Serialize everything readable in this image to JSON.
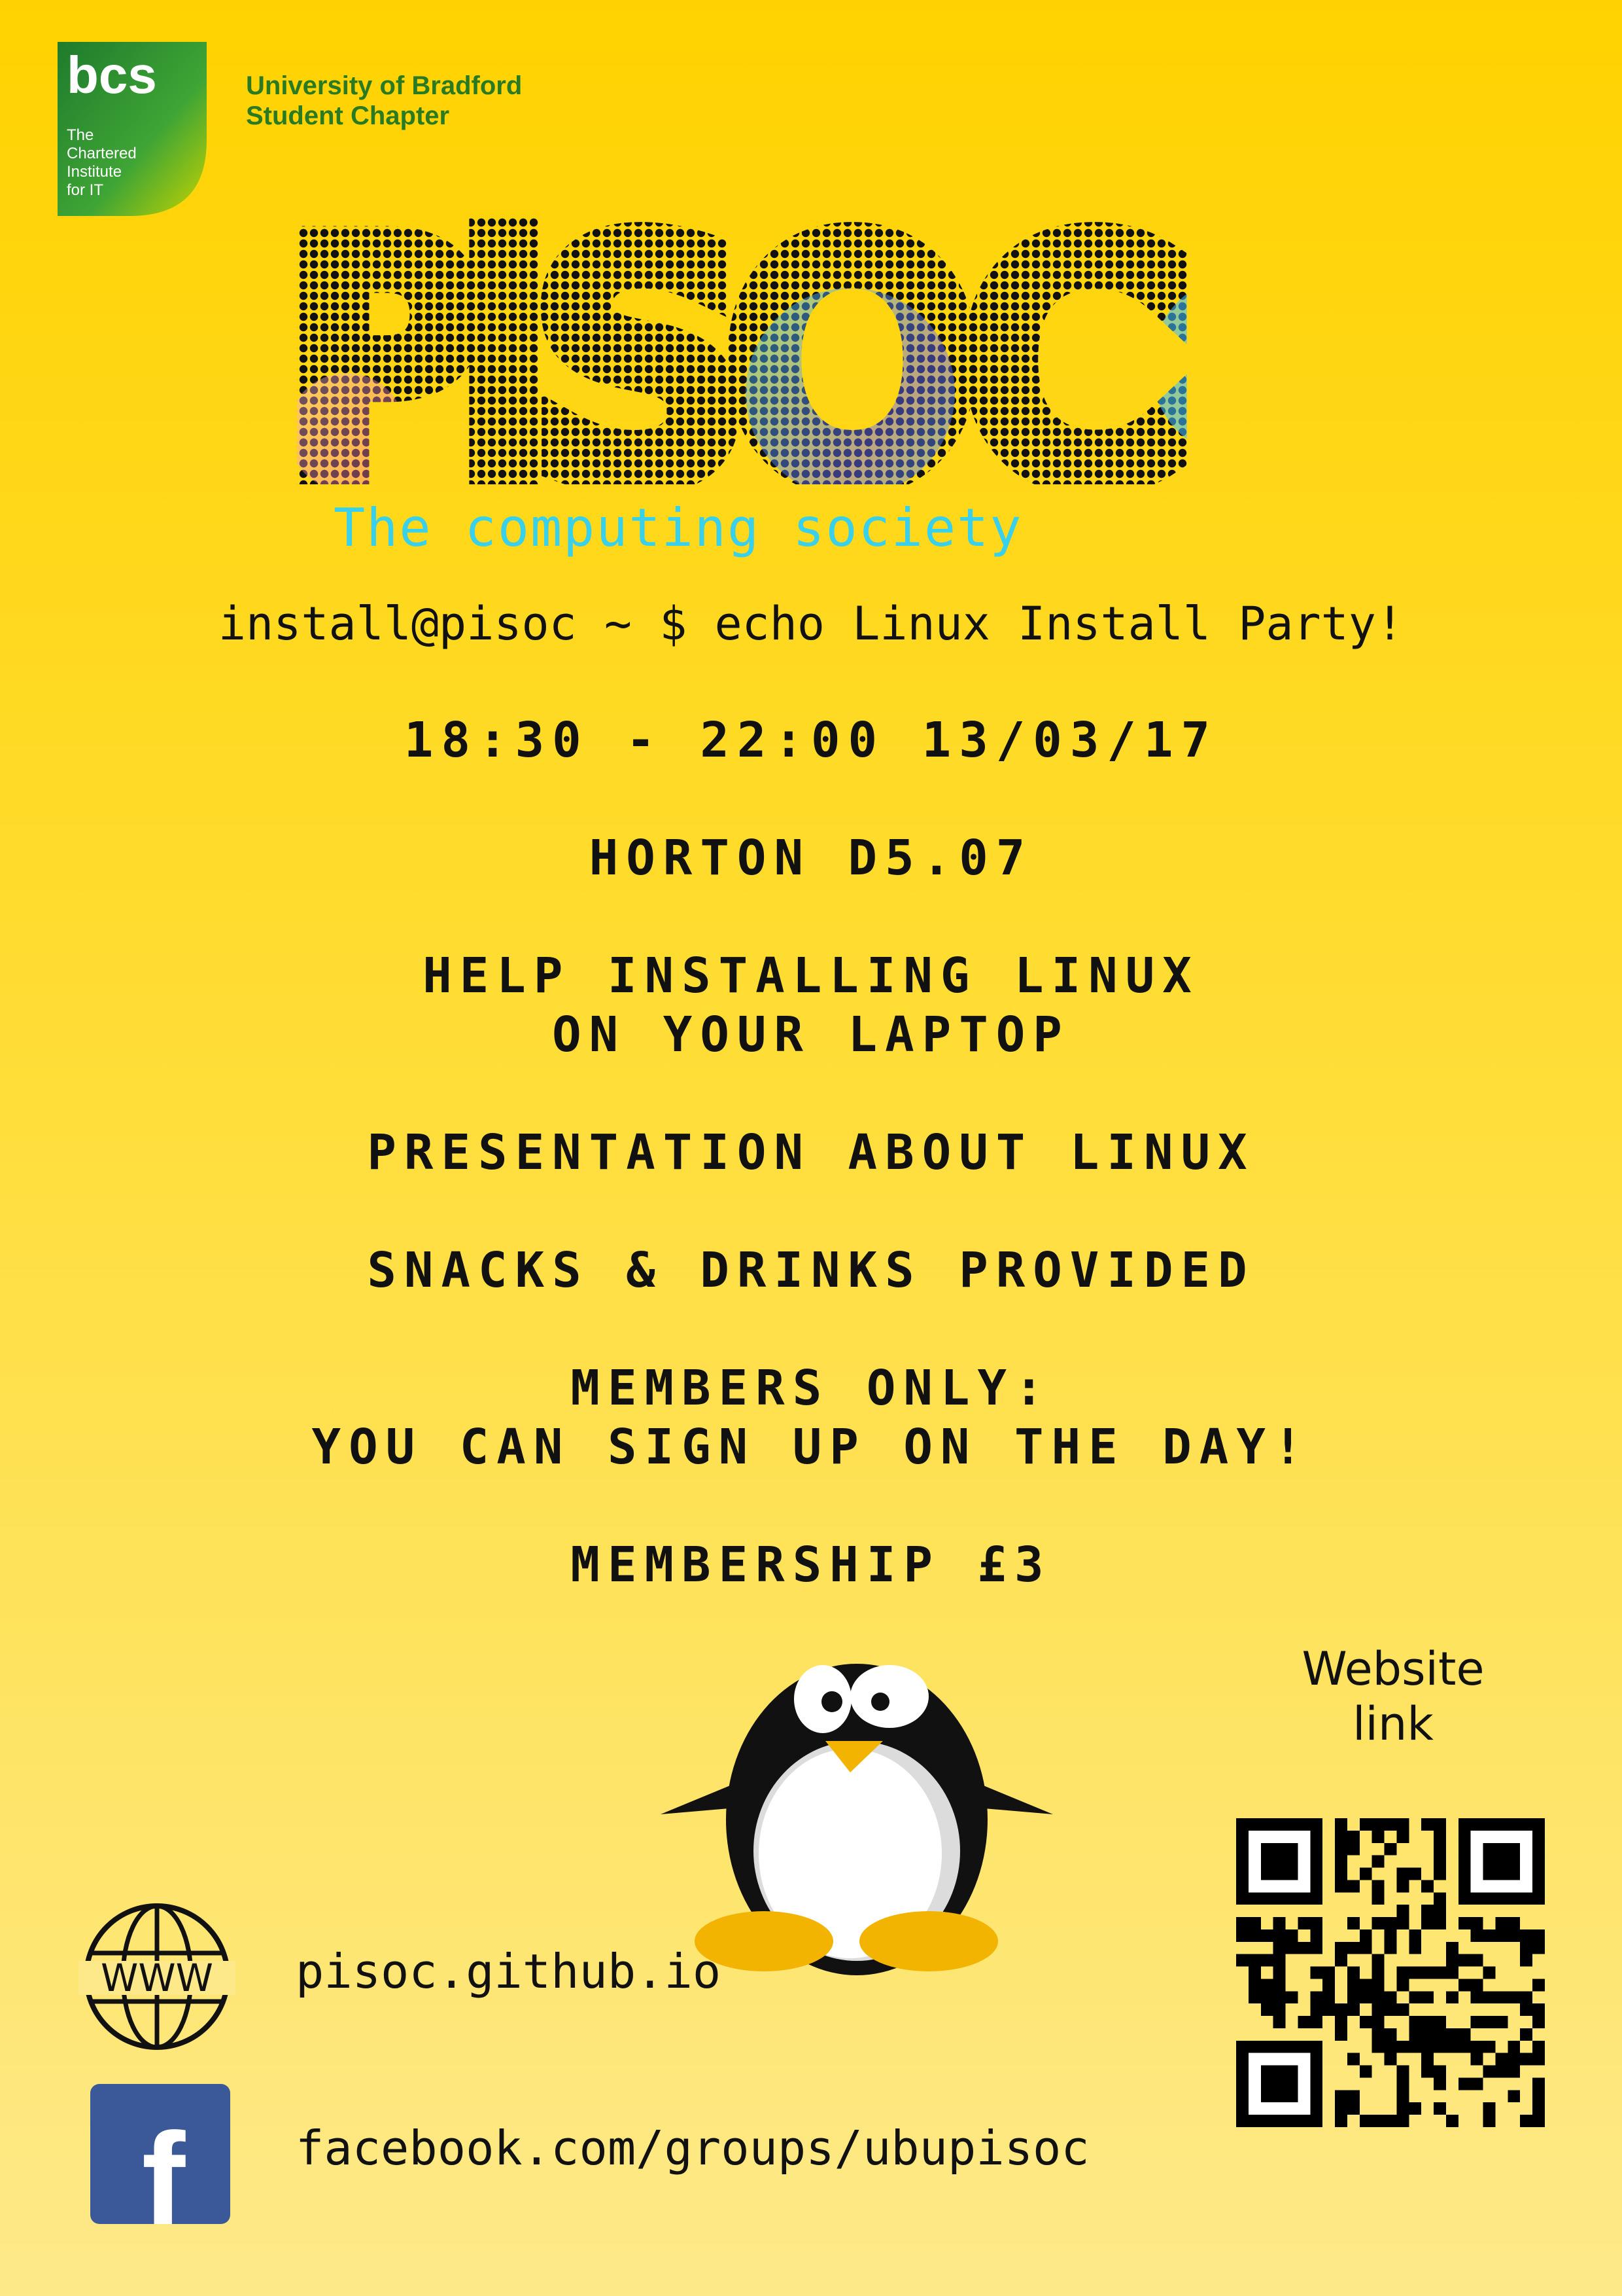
{
  "logo": {
    "bcs_text": "bcs",
    "institute_lines": [
      "The",
      "Chartered",
      "Institute",
      "for IT"
    ]
  },
  "chapter": {
    "line1": "University of Bradford",
    "line2": "Student Chapter"
  },
  "title": "PiSOC",
  "tagline": "The computing society",
  "command": "install@pisoc ~ $ echo Linux Install Party!",
  "details": {
    "time": "18:30 - 22:00 13/03/17",
    "location": "HORTON D5.07",
    "help_line1": "HELP INSTALLING LINUX",
    "help_line2": "ON YOUR LAPTOP",
    "presentation": "PRESENTATION ABOUT LINUX",
    "snacks": "SNACKS & DRINKS PROVIDED",
    "members_line1": "MEMBERS ONLY:",
    "members_line2": "YOU CAN SIGN UP ON THE DAY!",
    "membership": "MEMBERSHIP £3"
  },
  "website_label": {
    "line1": "Website",
    "line2": "link"
  },
  "links": {
    "website": "pisoc.github.io",
    "www_icon_text": "WWW",
    "facebook": "facebook.com/groups/ubupisoc",
    "facebook_glyph": "f"
  },
  "colors": {
    "bg_top": "#ffd200",
    "bg_bottom": "#fee98a",
    "tagline": "#38d0ea",
    "bcs_green": "#2a7a22",
    "facebook_blue": "#3b5998",
    "penguin_orange": "#f2b400"
  }
}
